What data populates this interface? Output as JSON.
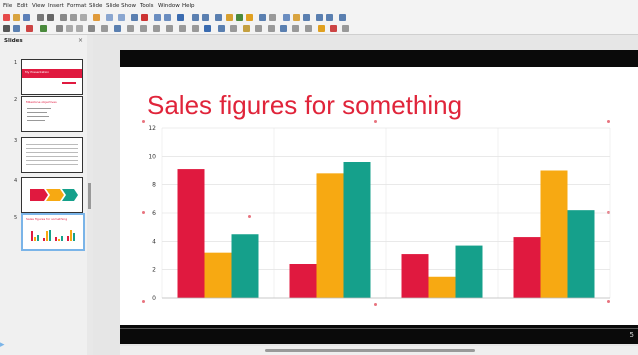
{
  "menu": [
    "File",
    "Edit",
    "View",
    "Insert",
    "Format",
    "Slide",
    "Slide Show",
    "Tools",
    "Window",
    "Help"
  ],
  "slides_panel": {
    "title": "Slides",
    "close": "×",
    "thumbs": [
      {
        "number": "1",
        "label": "My Presentation"
      },
      {
        "number": "2",
        "label": "Milestone objectives"
      },
      {
        "number": "3",
        "label": ""
      },
      {
        "number": "4",
        "label": ""
      },
      {
        "number": "5",
        "label": "Sales figures for something"
      }
    ]
  },
  "slide": {
    "title": "Sales figures for something",
    "number": "5"
  },
  "colors": {
    "red": "#e0193f",
    "orange": "#f7a912",
    "teal": "#15a08b",
    "accent": "#e0243a"
  },
  "chart_data": {
    "type": "bar",
    "categories": [
      "",
      "",
      "",
      ""
    ],
    "series": [
      {
        "values": [
          9.1,
          2.4,
          3.1,
          4.3
        ]
      },
      {
        "values": [
          3.2,
          8.8,
          1.5,
          9.0
        ]
      },
      {
        "values": [
          4.5,
          9.6,
          3.7,
          6.2
        ]
      }
    ],
    "ylim": [
      0,
      12
    ],
    "yticks": [
      "0",
      "2",
      "4",
      "6",
      "8",
      "10",
      "12"
    ],
    "grid": true
  }
}
